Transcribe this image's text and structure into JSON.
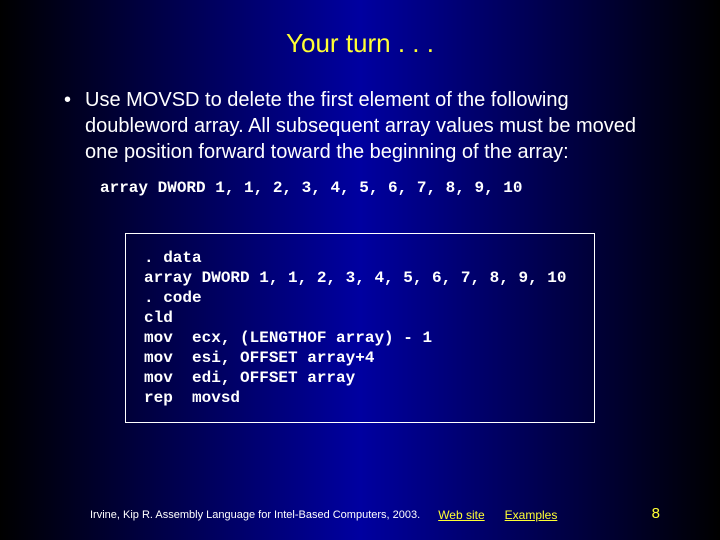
{
  "title": "Your turn . . .",
  "bullet": {
    "marker": "•",
    "text": "Use MOVSD to delete the first element of the following doubleword array. All subsequent array values must be moved one position forward toward the beginning of the array:"
  },
  "declaration": "array DWORD 1, 1, 2, 3, 4, 5, 6, 7, 8, 9, 10",
  "code": ". data\narray DWORD 1, 1, 2, 3, 4, 5, 6, 7, 8, 9, 10\n. code\ncld\nmov  ecx, (LENGTHOF array) - 1\nmov  esi, OFFSET array+4\nmov  edi, OFFSET array\nrep  movsd",
  "footer": {
    "credit": "Irvine, Kip R. Assembly Language for Intel-Based Computers, 2003.",
    "website_label": "Web site",
    "examples_label": "Examples",
    "page_number": "8"
  }
}
